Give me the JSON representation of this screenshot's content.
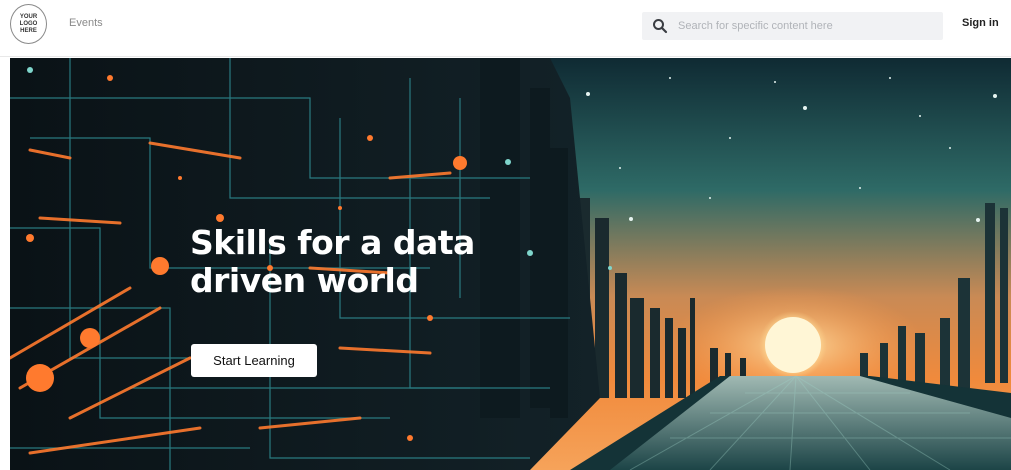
{
  "header": {
    "logo_lines": [
      "YOUR",
      "LOGO",
      "HERE"
    ],
    "nav": [
      {
        "label": "Events"
      }
    ],
    "search": {
      "placeholder": "Search for specific content here",
      "value": ""
    },
    "signin_label": "Sign in"
  },
  "hero": {
    "title_lines": [
      "Skills for a data",
      "driven world"
    ],
    "cta_label": "Start Learning"
  },
  "colors": {
    "cta_bg": "#ffffff",
    "hero_text": "#ffffff",
    "accent_orange": "#ff7a2e",
    "sky_teal": "#2f6f6a"
  }
}
